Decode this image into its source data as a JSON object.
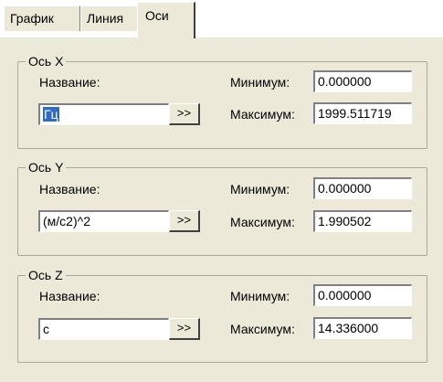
{
  "tabs": [
    {
      "label": "График"
    },
    {
      "label": "Линия"
    },
    {
      "label": "Оси",
      "active": true
    }
  ],
  "axes": [
    {
      "legend": "Ось X",
      "name_label": "Название:",
      "name_value": "Гц",
      "name_selected": true,
      "button_label": ">>",
      "min_label": "Минимум:",
      "min_value": "0.000000",
      "max_label": "Максимум:",
      "max_value": "1999.511719"
    },
    {
      "legend": "Ось Y",
      "name_label": "Название:",
      "name_value": "(м/с2)^2",
      "name_selected": false,
      "button_label": ">>",
      "min_label": "Минимум:",
      "min_value": "0.000000",
      "max_label": "Максимум:",
      "max_value": "1.990502"
    },
    {
      "legend": "Ось Z",
      "name_label": "Название:",
      "name_value": "с",
      "name_selected": false,
      "button_label": ">>",
      "min_label": "Минимум:",
      "min_value": "0.000000",
      "max_label": "Максимум:",
      "max_value": "14.336000"
    }
  ],
  "colors": {
    "selection": "#316ac5",
    "panel": "#ece9d8"
  }
}
